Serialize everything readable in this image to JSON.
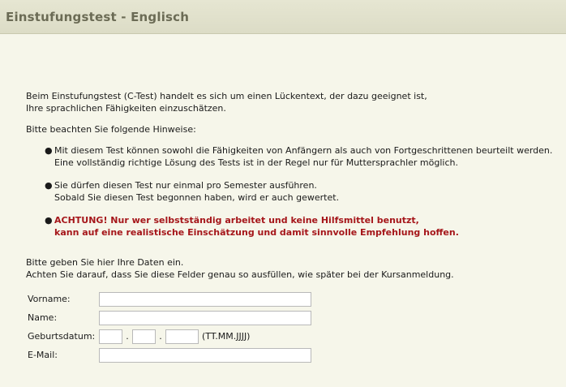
{
  "header": {
    "title": "Einstufungstest - Englisch"
  },
  "intro": {
    "line1": "Beim Einstufungstest (C-Test) handelt es sich um einen Lückentext, der dazu geeignet ist,",
    "line2": "Ihre sprachlichen Fähigkeiten einzuschätzen.",
    "hints_heading": "Bitte beachten Sie folgende Hinweise:"
  },
  "hints": [
    {
      "line1": "Mit diesem Test können sowohl die Fähigkeiten von Anfängern als auch von Fortgeschrittenen beurteilt werden.",
      "line2": "Eine vollständig richtige Lösung des Tests ist in der Regel nur für Muttersprachler möglich."
    },
    {
      "line1": "Sie dürfen diesen Test nur einmal pro Semester ausführen.",
      "line2": "Sobald Sie diesen Test begonnen haben, wird er auch gewertet."
    },
    {
      "line1": "ACHTUNG! Nur wer selbstständig arbeitet und keine Hilfsmittel benutzt,",
      "line2": "kann auf eine realistische Einschätzung und damit sinnvolle Empfehlung hoffen."
    }
  ],
  "form_intro": {
    "line1": "Bitte geben Sie hier Ihre Daten ein.",
    "line2": "Achten Sie darauf, dass Sie diese Felder genau so ausfüllen, wie später bei der Kursanmeldung."
  },
  "form": {
    "firstname_label": "Vorname:",
    "firstname_value": "",
    "name_label": "Name:",
    "name_value": "",
    "birthdate_label": "Geburtsdatum:",
    "birthdate_day": "",
    "birthdate_month": "",
    "birthdate_year": "",
    "date_separator": ".",
    "date_format_hint": "(TT.MM.JJJJ)",
    "email_label": "E-Mail:",
    "email_value": ""
  },
  "colors": {
    "background": "#f6f6ea",
    "header": "#e0e0cb",
    "title": "#6b6b55",
    "warning": "#a5161a"
  }
}
